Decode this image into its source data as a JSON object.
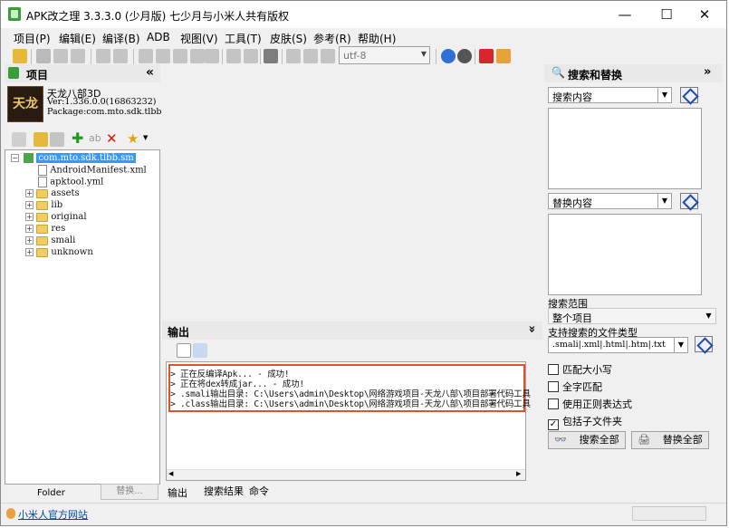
{
  "window": {
    "title": "APK改之理 3.3.3.0 (少月版) 七少月与小米人共有版权",
    "controls": {
      "minimize": "—",
      "maximize": "☐",
      "close": "✕"
    }
  },
  "menu": [
    "项目(P)",
    "编辑(E)",
    "编译(B)",
    "ADB",
    "视图(V)",
    "工具(T)",
    "皮肤(S)",
    "参考(R)",
    "帮助(H)"
  ],
  "toolbar": {
    "encoding": "utf-8"
  },
  "project_panel": {
    "header": "项目",
    "collapse": "«",
    "app_name": "天龙八部3D",
    "app_version": "Ver:1.336.0.0(16863232)",
    "app_package": "Package:com.mto.sdk.tlbb",
    "icon_text": "天龙",
    "tree_root": "com.mto.sdk.tlbb.sm",
    "files": [
      "AndroidManifest.xml",
      "apktool.yml"
    ],
    "folders": [
      "assets",
      "lib",
      "original",
      "res",
      "smali",
      "unknown"
    ],
    "tab_folder": "Folder",
    "tab_replace": "替换..."
  },
  "output_panel": {
    "header": "输出",
    "collapse": "»",
    "lines": [
      "> 正在反编译Apk... - 成功!",
      "> 正在将dex转成jar... - 成功!",
      "> .smali输出目录: C:\\Users\\admin\\Desktop\\网络游戏项目-天龙八部\\项目部署代码工具",
      "> .class输出目录: C:\\Users\\admin\\Desktop\\网络游戏项目-天龙八部\\项目部署代码工具"
    ],
    "tabs": [
      "输出",
      "搜索结果",
      "命令"
    ]
  },
  "search_panel": {
    "header": "搜索和替换",
    "collapse": "»",
    "search_label": "搜索内容",
    "replace_label": "替换内容",
    "scope_label": "搜索范围",
    "scope_value": "整个项目",
    "filetype_label": "支持搜索的文件类型",
    "filetype_value": ".smali|.xml|.html|.htm|.txt",
    "options": [
      {
        "label": "匹配大小写",
        "checked": false
      },
      {
        "label": "全字匹配",
        "checked": false
      },
      {
        "label": "使用正则表达式",
        "checked": false
      },
      {
        "label": "包括子文件夹",
        "checked": true
      }
    ],
    "search_all": "搜索全部",
    "replace_all": "替换全部"
  },
  "statusbar": {
    "link": "小米人官方网站"
  },
  "colors": {
    "highlight_box": "#e0532a",
    "tree_selected": "#3399ff"
  }
}
